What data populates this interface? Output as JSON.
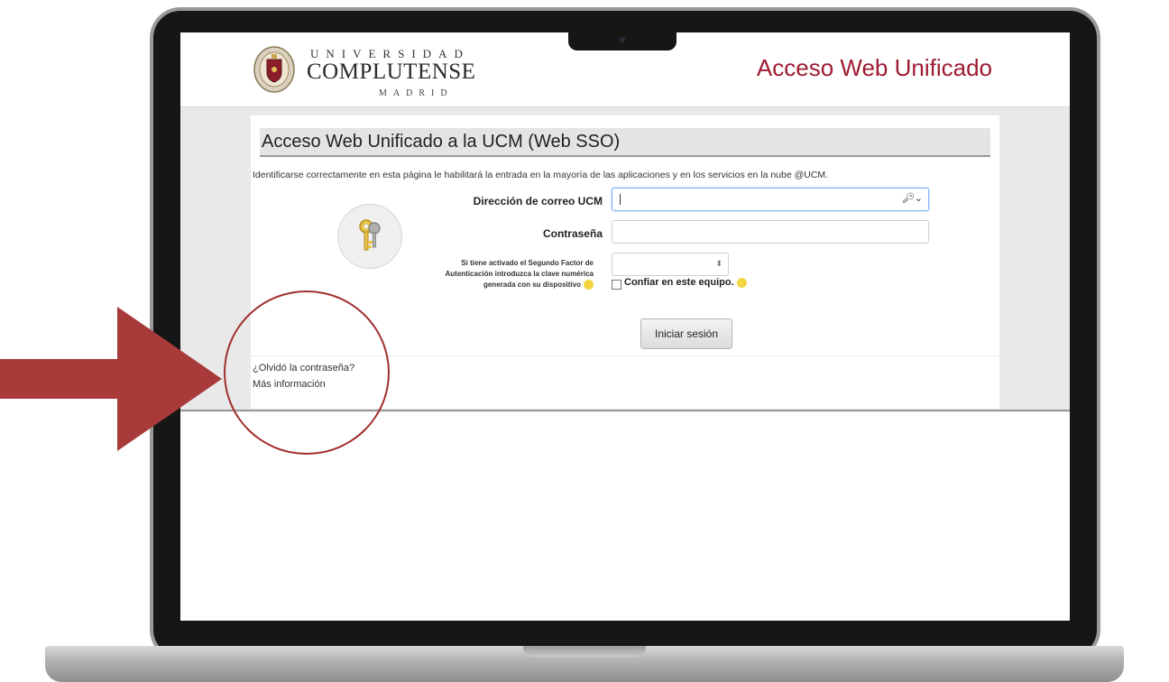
{
  "header": {
    "logo_line1": "UNIVERSIDAD",
    "logo_line2": "COMPLUTENSE",
    "logo_line3": "MADRID",
    "title": "Acceso Web Unificado"
  },
  "panel": {
    "title": "Acceso Web Unificado a la UCM (Web SSO)",
    "intro": "Identificarse correctamente en esta página le habilitará la entrada en la mayoría de las aplicaciones y en los servicios en la nube @UCM."
  },
  "form": {
    "email_label": "Dirección de correo UCM",
    "email_value": "",
    "password_label": "Contraseña",
    "password_value": "",
    "otp_label": "Si tiene activado el Segundo Factor de Autenticación introduzca la clave numérica generada con su dispositivo",
    "otp_value": "",
    "trust_label": "Confiar en este equipo.",
    "trust_checked": false,
    "submit_label": "Iniciar sesión"
  },
  "links": {
    "forgot": "¿Olvidó la contraseña?",
    "more_info": "Más información"
  },
  "colors": {
    "brand": "#9e1b32",
    "annotation": "#a12e2e"
  }
}
